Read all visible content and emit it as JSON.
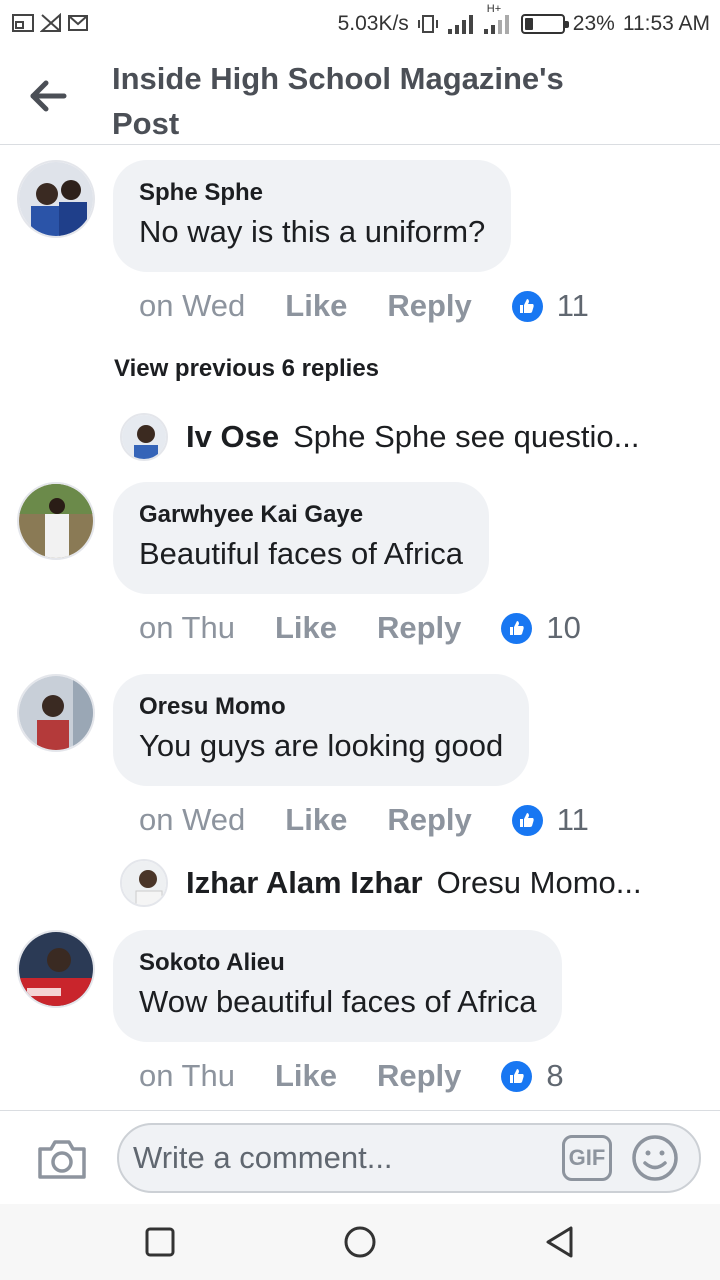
{
  "status_bar": {
    "speed": "5.03K/s",
    "network": "H+",
    "battery_percent": "23%",
    "battery_level": 0.23,
    "time": "11:53 AM"
  },
  "header": {
    "title": "Inside High School Magazine's Post",
    "back_icon": "arrow-left-icon"
  },
  "comments": [
    {
      "author": "Sphe Sphe",
      "text": "No way is this a uniform?",
      "time": "on Wed",
      "like_label": "Like",
      "reply_label": "Reply",
      "likes": "11"
    },
    {
      "author": "Garwhyee Kai Gaye",
      "text": "Beautiful faces of Africa",
      "time": "on Thu",
      "like_label": "Like",
      "reply_label": "Reply",
      "likes": "10"
    },
    {
      "author": "Oresu Momo",
      "text": "You guys are looking good",
      "time": "on Wed",
      "like_label": "Like",
      "reply_label": "Reply",
      "likes": "11"
    },
    {
      "author": "Sokoto Alieu",
      "text": "Wow beautiful faces of Africa",
      "time": "on Thu",
      "like_label": "Like",
      "reply_label": "Reply",
      "likes": "8"
    }
  ],
  "view_previous": "View previous 6 replies",
  "replies": [
    {
      "name": "Iv Ose",
      "text": "Sphe Sphe  see questio..."
    },
    {
      "name": "Izhar Alam Izhar",
      "text": "Oresu Momo..."
    }
  ],
  "composer": {
    "placeholder": "Write a comment...",
    "gif_label": "GIF"
  },
  "colors": {
    "accent": "#1877f2",
    "bubble": "#f0f2f5",
    "muted": "#8d949e"
  }
}
